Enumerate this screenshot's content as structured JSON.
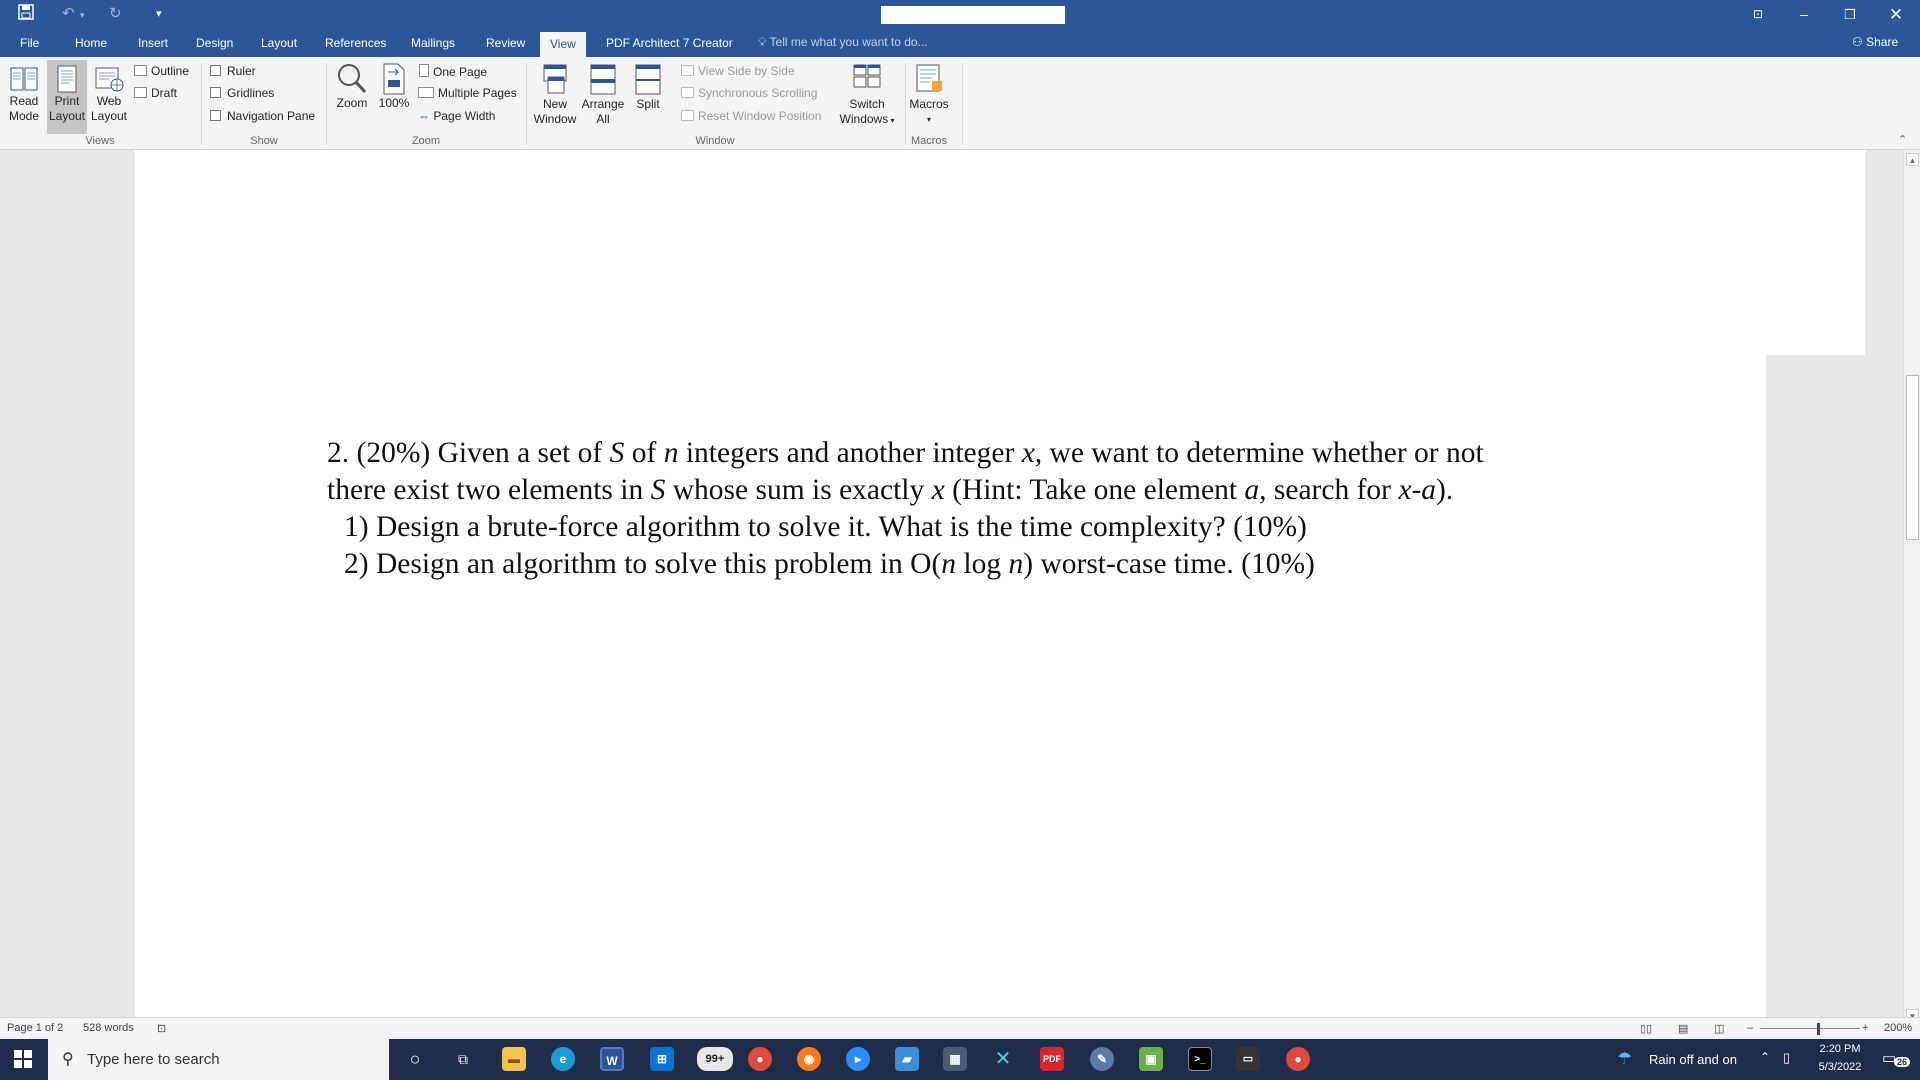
{
  "title_bar": {
    "save_icon": "save-icon",
    "undo_icon": "undo-icon",
    "redo_icon": "redo-icon",
    "customize_icon": "customize-quick-access-icon"
  },
  "tabs": [
    "File",
    "Home",
    "Insert",
    "Design",
    "Layout",
    "References",
    "Mailings",
    "Review",
    "View",
    "PDF Architect 7 Creator"
  ],
  "active_tab": "View",
  "tell_me": "Tell me what you want to do...",
  "share": "Share",
  "ribbon": {
    "views": {
      "read_mode_1": "Read",
      "read_mode_2": "Mode",
      "print_layout_1": "Print",
      "print_layout_2": "Layout",
      "web_layout_1": "Web",
      "web_layout_2": "Layout",
      "outline": "Outline",
      "draft": "Draft",
      "group": "Views"
    },
    "show": {
      "ruler": "Ruler",
      "gridlines": "Gridlines",
      "navigation_pane": "Navigation Pane",
      "group": "Show"
    },
    "zoom": {
      "zoom": "Zoom",
      "hundred": "100%",
      "one_page": "One Page",
      "multiple_pages": "Multiple Pages",
      "page_width": "Page Width",
      "group": "Zoom"
    },
    "window": {
      "new_window_1": "New",
      "new_window_2": "Window",
      "arrange_1": "Arrange",
      "arrange_2": "All",
      "split": "Split",
      "side_by_side": "View Side by Side",
      "sync_scrolling": "Synchronous Scrolling",
      "reset_position": "Reset Window Position",
      "switch_1": "Switch",
      "switch_2": "Windows",
      "group": "Window"
    },
    "macros": {
      "macros": "Macros",
      "group": "Macros"
    }
  },
  "document": {
    "line1_a": "2. (20%) Given a set of ",
    "line1_s": "S",
    "line1_b": " of ",
    "line1_n": "n",
    "line1_c": " integers and another integer ",
    "line1_x": "x,",
    "line1_d": " we want to determine whether or not",
    "line2_a": "there exist two elements in ",
    "line2_s": "S",
    "line2_b": " whose sum is exactly ",
    "line2_x": "x",
    "line2_c": " (Hint: Take one element ",
    "line2_a2": "a",
    "line2_d": ", search for ",
    "line2_xa": "x-a",
    "line2_e": ").",
    "line3": "1) Design a brute-force algorithm to solve it. What is the time complexity? (10%)",
    "line4_a": "2) Design an algorithm to solve this problem in O(",
    "line4_n1": "n",
    "line4_b": " log ",
    "line4_n2": "n",
    "line4_c": ") worst-case time. (10%)"
  },
  "status": {
    "page": "Page 1 of 2",
    "words": "528 words",
    "zoom": "200%"
  },
  "taskbar": {
    "search_placeholder": "Type here to search",
    "badge": "99+",
    "weather": "Rain off and on",
    "time": "2:20 PM",
    "date": "5/3/2022",
    "notifications": "26"
  }
}
